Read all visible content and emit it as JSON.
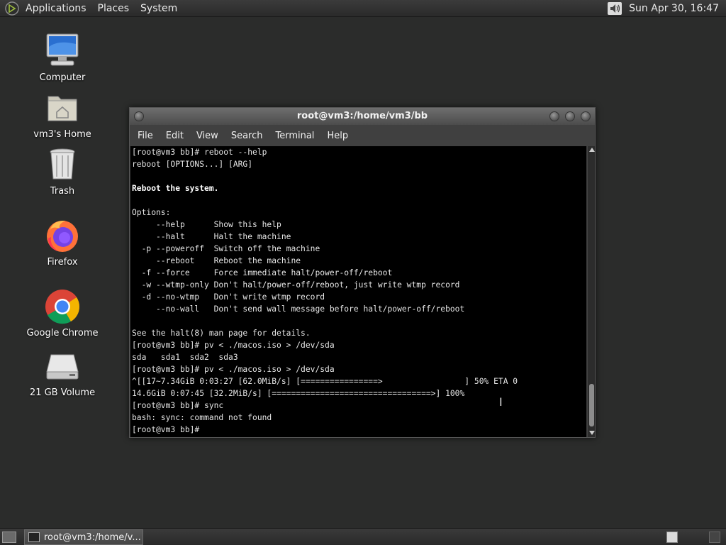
{
  "top_panel": {
    "menus": [
      "Applications",
      "Places",
      "System"
    ],
    "clock": "Sun Apr 30, 16:47"
  },
  "desktop_icons": [
    {
      "label": "Computer",
      "icon": "computer-icon"
    },
    {
      "label": "vm3's Home",
      "icon": "home-folder-icon"
    },
    {
      "label": "Trash",
      "icon": "trash-icon"
    },
    {
      "label": "Firefox",
      "icon": "firefox-icon"
    },
    {
      "label": "Google Chrome",
      "icon": "chrome-icon"
    },
    {
      "label": "21 GB Volume",
      "icon": "drive-icon"
    }
  ],
  "terminal": {
    "title": "root@vm3:/home/vm3/bb",
    "menu": [
      "File",
      "Edit",
      "View",
      "Search",
      "Terminal",
      "Help"
    ],
    "lines": [
      {
        "text": "[root@vm3 bb]# reboot --help"
      },
      {
        "text": "reboot [OPTIONS...] [ARG]"
      },
      {
        "text": ""
      },
      {
        "text": "Reboot the system.",
        "bold": true
      },
      {
        "text": ""
      },
      {
        "text": "Options:"
      },
      {
        "text": "     --help      Show this help"
      },
      {
        "text": "     --halt      Halt the machine"
      },
      {
        "text": "  -p --poweroff  Switch off the machine"
      },
      {
        "text": "     --reboot    Reboot the machine"
      },
      {
        "text": "  -f --force     Force immediate halt/power-off/reboot"
      },
      {
        "text": "  -w --wtmp-only Don't halt/power-off/reboot, just write wtmp record"
      },
      {
        "text": "  -d --no-wtmp   Don't write wtmp record"
      },
      {
        "text": "     --no-wall   Don't send wall message before halt/power-off/reboot"
      },
      {
        "text": ""
      },
      {
        "text": "See the halt(8) man page for details."
      },
      {
        "text": "[root@vm3 bb]# pv < ./macos.iso > /dev/sda"
      },
      {
        "text": "sda   sda1  sda2  sda3"
      },
      {
        "text": "[root@vm3 bb]# pv < ./macos.iso > /dev/sda"
      },
      {
        "text": "^[[17~7.34GiB 0:03:27 [62.0MiB/s] [================>                 ] 50% ETA 0"
      },
      {
        "text": "14.6GiB 0:07:45 [32.2MiB/s] [=================================>] 100%"
      },
      {
        "text": "[root@vm3 bb]# sync"
      },
      {
        "text": "bash: sync: command not found"
      },
      {
        "text": "[root@vm3 bb]# "
      }
    ]
  },
  "bottom_panel": {
    "task_label": "root@vm3:/home/v..."
  }
}
